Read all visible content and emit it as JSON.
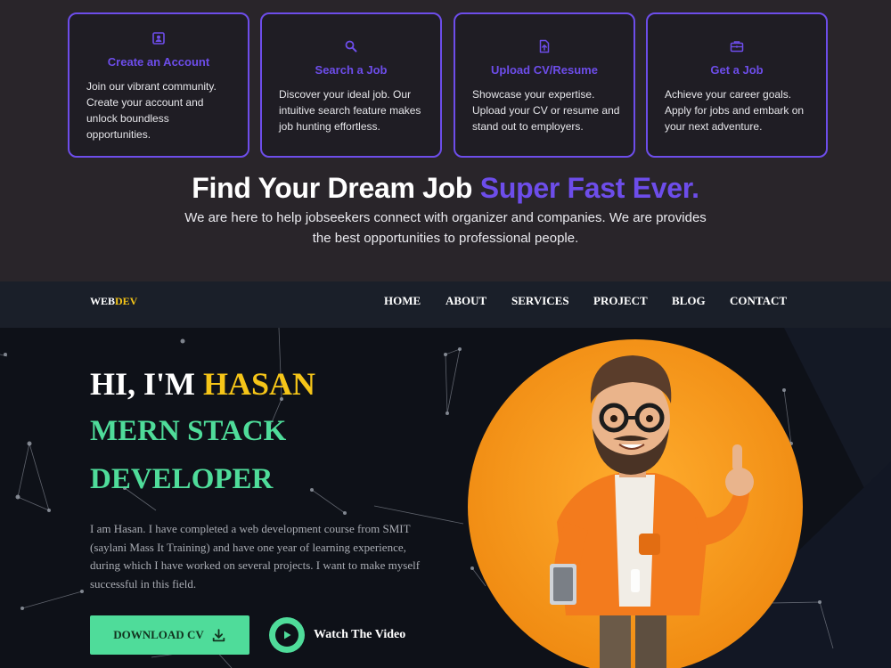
{
  "features": {
    "cards": [
      {
        "icon": "id-card-icon",
        "title": "Create an Account",
        "lines": [
          "Join our vibrant community.",
          "Create your account and",
          "unlock boundless",
          "opportunities."
        ]
      },
      {
        "icon": "search-icon",
        "title": "Search a Job",
        "lines": [
          "Discover your ideal job. Our",
          "intuitive search feature makes",
          "job hunting effortless."
        ]
      },
      {
        "icon": "file-upload-icon",
        "title": "Upload CV/Resume",
        "lines": [
          "Showcase your expertise.",
          "Upload your CV or resume and",
          "stand out to employers."
        ]
      },
      {
        "icon": "briefcase-icon",
        "title": "Get a Job",
        "lines": [
          "Achieve your career goals.",
          "Apply for jobs and embark on",
          "your next adventure."
        ]
      }
    ],
    "headline_main": "Find Your Dream Job ",
    "headline_accent": "Super Fast Ever.",
    "sub_line1": "We are here to help jobseekers connect with organizer and companies. We are provides",
    "sub_line2": "the best opportunities to professional people."
  },
  "nav": {
    "logo_web": "WEB",
    "logo_dev": "DEV",
    "items": [
      "HOME",
      "ABOUT",
      "SERVICES",
      "PROJECT",
      "BLOG",
      "CONTACT"
    ]
  },
  "hero": {
    "greeting": "HI, I'M ",
    "name": "HASAN",
    "role_line1": "MERN STACK",
    "role_line2": "DEVELOPER",
    "bio_lines": [
      "I am Hasan. I have completed a web development course from SMIT",
      "(saylani Mass It Training) and have one year of learning experience,",
      "during which I have worked on several projects. I want to make myself",
      "successful in this field."
    ],
    "download_label": "DOWNLOAD CV",
    "watch_label": "Watch The Video"
  },
  "colors": {
    "accent_purple": "#6d4dea",
    "accent_green": "#4fdc9a",
    "accent_yellow": "#f5c518",
    "avatar_orange": "#f5a020"
  }
}
